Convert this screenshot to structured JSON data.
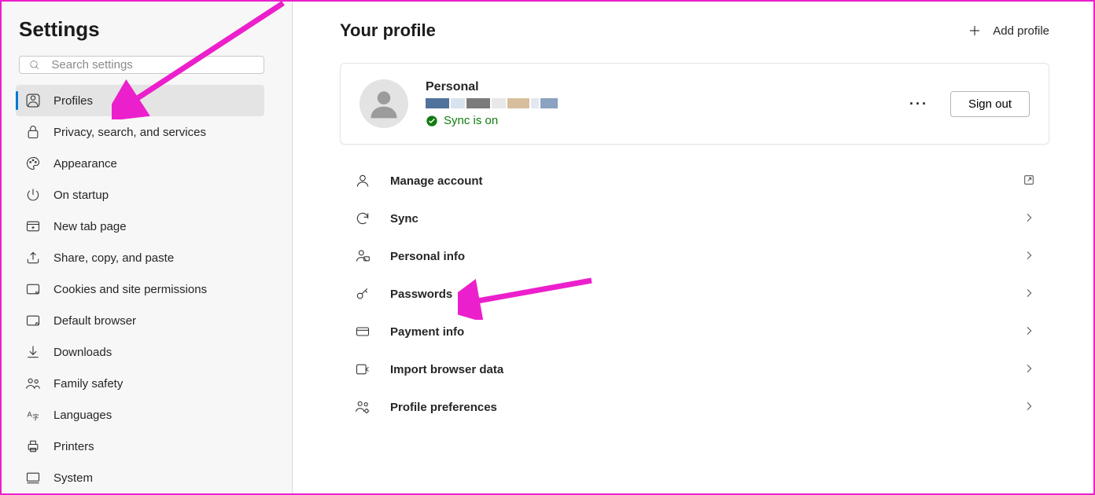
{
  "sidebar": {
    "title": "Settings",
    "search_placeholder": "Search settings",
    "items": [
      {
        "label": "Profiles",
        "selected": true
      },
      {
        "label": "Privacy, search, and services"
      },
      {
        "label": "Appearance"
      },
      {
        "label": "On startup"
      },
      {
        "label": "New tab page"
      },
      {
        "label": "Share, copy, and paste"
      },
      {
        "label": "Cookies and site permissions"
      },
      {
        "label": "Default browser"
      },
      {
        "label": "Downloads"
      },
      {
        "label": "Family safety"
      },
      {
        "label": "Languages"
      },
      {
        "label": "Printers"
      },
      {
        "label": "System"
      }
    ]
  },
  "main": {
    "title": "Your profile",
    "add_profile": "Add profile",
    "profile": {
      "name": "Personal",
      "sync": "Sync is on",
      "sign_out": "Sign out"
    },
    "items": [
      {
        "label": "Manage account",
        "action": "external"
      },
      {
        "label": "Sync",
        "action": "chevron"
      },
      {
        "label": "Personal info",
        "action": "chevron"
      },
      {
        "label": "Passwords",
        "action": "chevron"
      },
      {
        "label": "Payment info",
        "action": "chevron"
      },
      {
        "label": "Import browser data",
        "action": "chevron"
      },
      {
        "label": "Profile preferences",
        "action": "chevron"
      }
    ]
  },
  "annotations": {
    "color": "#ec1fcc"
  }
}
